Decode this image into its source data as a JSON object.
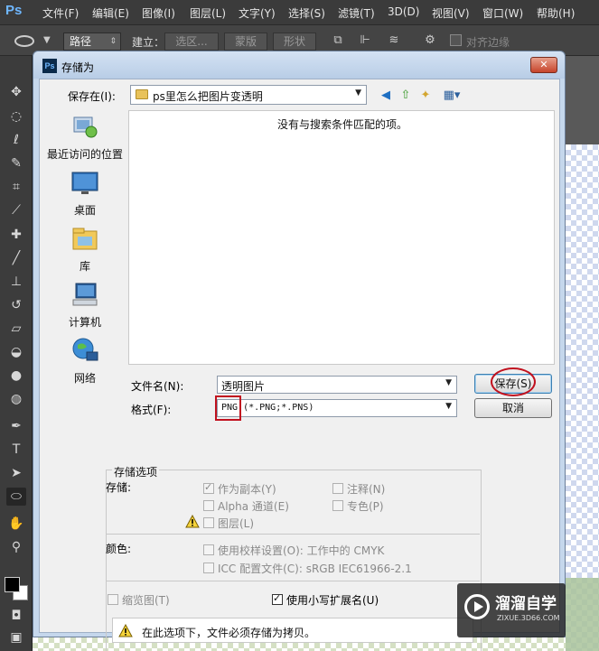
{
  "app": {
    "logo": "Ps",
    "menu": [
      "文件(F)",
      "编辑(E)",
      "图像(I)",
      "图层(L)",
      "文字(Y)",
      "选择(S)",
      "滤镜(T)",
      "3D(D)",
      "视图(V)",
      "窗口(W)",
      "帮助(H)"
    ]
  },
  "options_bar": {
    "mode_value": "路径",
    "make_label": "建立：",
    "selection_btn": "选区...",
    "mask_btn": "蒙版",
    "shape_btn": "形状",
    "align_edges_label": "对齐边缘",
    "icons": [
      "ellipse-tool-icon",
      "path-ops-icon",
      "path-align-icon",
      "path-arrange-icon",
      "gear-icon"
    ]
  },
  "toolbar": {
    "tools": [
      "move-icon",
      "marquee-icon",
      "lasso-icon",
      "quick-select-icon",
      "crop-icon",
      "eyedropper-icon",
      "healing-icon",
      "brush-icon",
      "stamp-icon",
      "history-brush-icon",
      "eraser-icon",
      "paint-bucket-icon",
      "blur-icon",
      "dodge-icon",
      "pen-icon",
      "type-icon",
      "path-select-icon",
      "ellipse-icon",
      "hand-icon",
      "zoom-icon"
    ],
    "foreground_color": "#000000",
    "background_color": "#ffffff"
  },
  "dialog": {
    "title": "存储为",
    "save_in_label": "保存在(I):",
    "current_folder": "ps里怎么把图片变透明",
    "places": [
      {
        "label": "最近访问的位置",
        "icon": "recent-places-icon"
      },
      {
        "label": "桌面",
        "icon": "desktop-icon"
      },
      {
        "label": "库",
        "icon": "libraries-icon"
      },
      {
        "label": "计算机",
        "icon": "computer-icon"
      },
      {
        "label": "网络",
        "icon": "network-icon"
      }
    ],
    "empty_message": "没有与搜索条件匹配的项。",
    "filename_label": "文件名(N):",
    "filename_value": "透明图片",
    "format_label": "格式(F):",
    "format_value": "PNG (*.PNG;*.PNS)",
    "save_button": "保存(S)",
    "cancel_button": "取消",
    "save_options": {
      "group_title": "存储选项",
      "store_label": "存储:",
      "as_copy": {
        "label": "作为副本(Y)",
        "checked": true
      },
      "notes": {
        "label": "注释(N)",
        "checked": false
      },
      "alpha": {
        "label": "Alpha 通道(E)",
        "checked": false
      },
      "spot": {
        "label": "专色(P)",
        "checked": false
      },
      "layers": {
        "label": "图层(L)",
        "checked": false
      },
      "color_label": "颜色:",
      "proof": {
        "label": "使用校样设置(O):  工作中的 CMYK",
        "checked": false
      },
      "icc": {
        "label": "ICC 配置文件(C):  sRGB IEC61966-2.1",
        "checked": false
      },
      "thumbnail": {
        "label": "缩览图(T)",
        "checked": false
      },
      "lowercase_ext": {
        "label": "使用小写扩展名(U)",
        "checked": true
      },
      "notice": "在此选项下，文件必须存储为拷贝。"
    }
  },
  "watermark": {
    "title": "溜溜自学",
    "url": "ZIXUE.3D66.COM"
  }
}
